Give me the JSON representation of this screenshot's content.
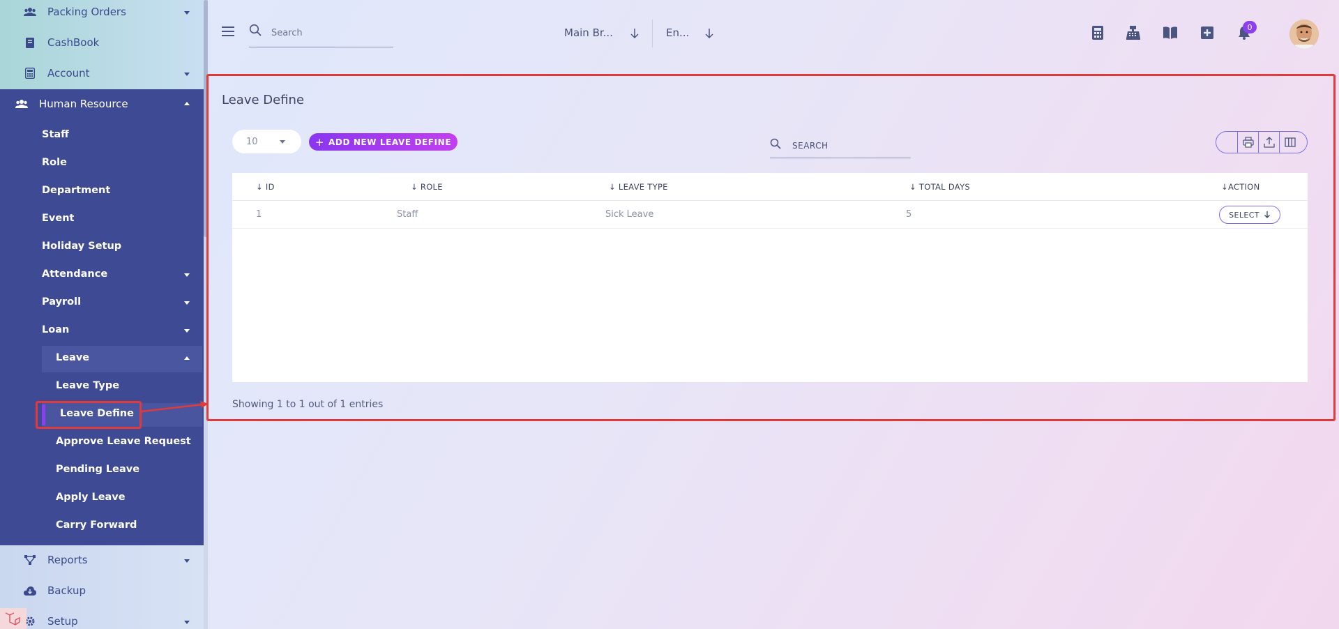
{
  "sidebar": {
    "top_items": [
      {
        "label": "Packing Orders",
        "icon": "users-icon",
        "has_caret": true
      },
      {
        "label": "CashBook",
        "icon": "book-icon",
        "has_caret": false
      },
      {
        "label": "Account",
        "icon": "calculator-icon",
        "has_caret": true
      }
    ],
    "section": {
      "label": "Human Resource",
      "icon": "users-icon"
    },
    "hr_items": [
      "Staff",
      "Role",
      "Department",
      "Event",
      "Holiday Setup",
      "Attendance",
      "Payroll",
      "Loan"
    ],
    "leave_group": {
      "label": "Leave"
    },
    "leave_items": [
      "Leave Type",
      "Leave Define",
      "Approve Leave Request",
      "Pending Leave",
      "Apply Leave",
      "Carry Forward"
    ],
    "active_item": "Leave Define",
    "bottom_items": [
      {
        "label": "Reports",
        "icon": "share-nodes-icon",
        "has_caret": true
      },
      {
        "label": "Backup",
        "icon": "cloud-download-icon",
        "has_caret": false
      },
      {
        "label": "Setup",
        "icon": "gear-icon",
        "has_caret": true
      }
    ]
  },
  "header": {
    "search_placeholder": "Search",
    "branch_select": "Main Br...",
    "language_select": "En...",
    "icons": [
      "calculator-icon",
      "cash-register-icon",
      "book-open-icon",
      "plus-square-icon",
      "bell-icon"
    ],
    "notification_count": "0"
  },
  "page": {
    "title": "Leave Define",
    "per_page": "10",
    "add_button": "ADD NEW LEAVE DEFINE",
    "search_placeholder": "SEARCH",
    "columns": [
      "ID",
      "ROLE",
      "LEAVE TYPE",
      "TOTAL DAYS",
      "ACTION"
    ],
    "rows": [
      {
        "id": "1",
        "role": "Staff",
        "leave_type": "Sick Leave",
        "total_days": "5",
        "action": "SELECT"
      }
    ],
    "footer": "Showing 1 to 1 out of 1 entries"
  },
  "colors": {
    "sidebar_active": "#3f4a95",
    "accent": "#8b3ff0",
    "highlight": "#e03a3a"
  }
}
